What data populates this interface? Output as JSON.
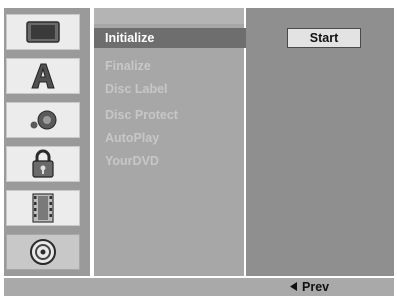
{
  "sidebar": {
    "items": [
      {
        "icon": "tv-screen-icon",
        "active": false
      },
      {
        "icon": "letter-a-icon",
        "active": false
      },
      {
        "icon": "speaker-audio-icon",
        "active": false
      },
      {
        "icon": "padlock-icon",
        "active": false
      },
      {
        "icon": "film-strip-icon",
        "active": false
      },
      {
        "icon": "disc-icon",
        "active": true
      }
    ]
  },
  "menu": {
    "items": [
      {
        "label": "Initialize",
        "selected": true
      },
      {
        "label": "Finalize",
        "selected": false
      },
      {
        "label": "Disc Label",
        "selected": false
      },
      {
        "label": "Disc Protect",
        "selected": false
      },
      {
        "label": "AutoPlay",
        "selected": false
      },
      {
        "label": "YourDVD",
        "selected": false
      }
    ]
  },
  "options": {
    "start_label": "Start"
  },
  "footer": {
    "prev_icon": "left-arrow-icon",
    "prev_label": "Prev"
  }
}
